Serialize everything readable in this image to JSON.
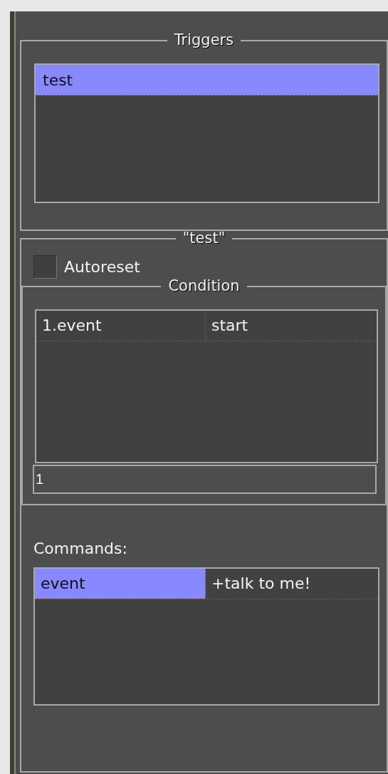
{
  "triggers": {
    "title": "Triggers",
    "items": [
      {
        "label": "test",
        "selected": true
      }
    ]
  },
  "trigger_detail": {
    "title": "\"test\"",
    "autoreset": {
      "label": "Autoreset",
      "checked": false
    },
    "condition": {
      "title": "Condition",
      "rows": [
        {
          "cells": [
            {
              "text": "1.event",
              "selected": false
            },
            {
              "text": "start",
              "selected": false
            }
          ]
        }
      ],
      "input": {
        "value": "1"
      }
    },
    "commands": {
      "label": "Commands:",
      "rows": [
        {
          "cells": [
            {
              "text": "event",
              "selected": true
            },
            {
              "text": "+talk to me!",
              "selected": false
            }
          ]
        }
      ]
    }
  }
}
